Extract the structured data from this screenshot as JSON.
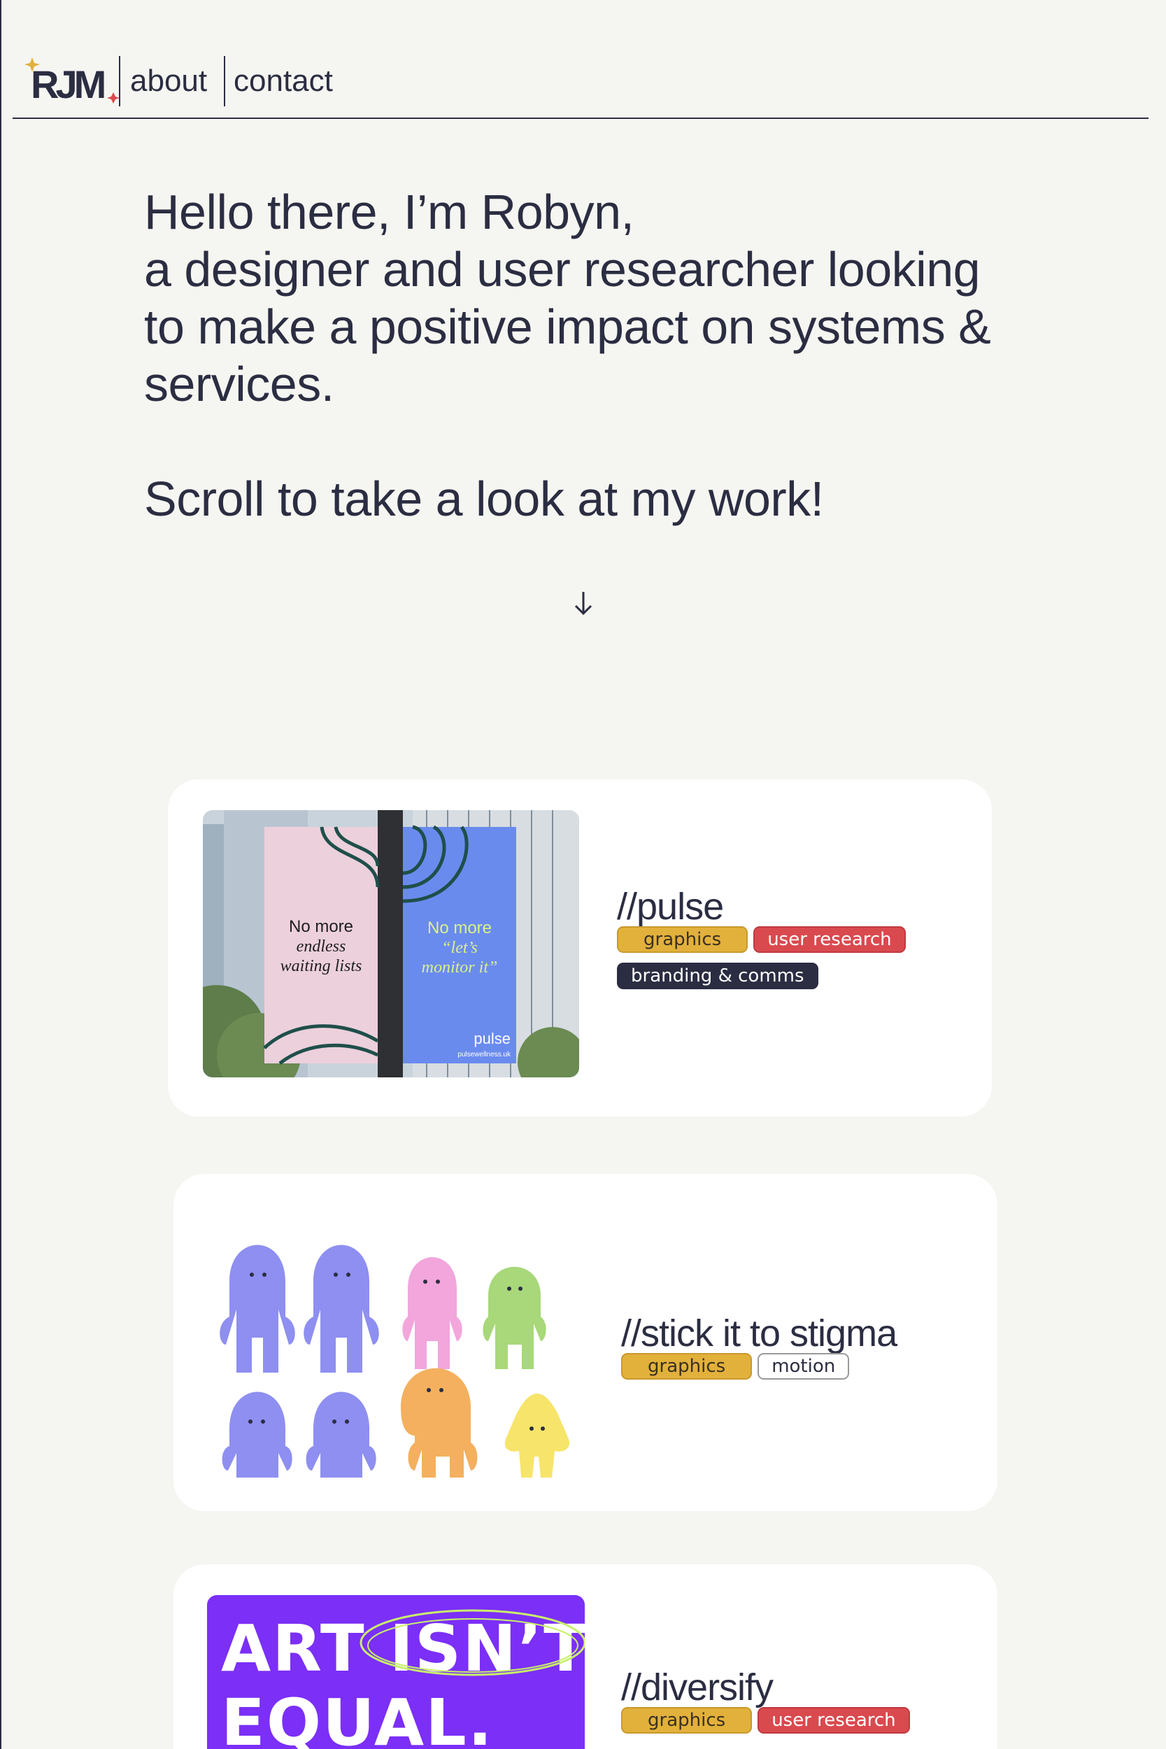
{
  "nav": {
    "logo_text": "RJM",
    "links": [
      {
        "label": "about"
      },
      {
        "label": "contact"
      }
    ]
  },
  "intro": {
    "greeting": "Hello there, I’m Robyn,",
    "line1": "a designer and user researcher looking",
    "line2": "to make a positive impact on systems &",
    "line3": "services.",
    "cta": "Scroll to take a look at my work!",
    "arrow": "↓"
  },
  "projects": [
    {
      "title": "//pulse",
      "tags": [
        "graphics",
        "user research",
        "branding & comms"
      ],
      "image": {
        "icon": "street-banner-image",
        "banner_left": {
          "line1": "No more",
          "line2": "endless",
          "line3": "waiting lists"
        },
        "banner_right": {
          "line1": "No more",
          "line2": "“let’s",
          "line3": "monitor it”",
          "brand": "pulse",
          "url": "pulsewellness.uk"
        }
      }
    },
    {
      "title": "//stick it to stigma",
      "tags": [
        "graphics",
        "motion"
      ],
      "image": {
        "icon": "characters-illustration"
      }
    },
    {
      "title": "//diversify",
      "tags": [
        "graphics",
        "user research"
      ],
      "image": {
        "icon": "art-poster-image",
        "line1": "ART ISN’T",
        "line2": "EQUAL."
      }
    }
  ],
  "colors": {
    "background": "#f5f5f1",
    "ink": "#2b2d42",
    "graphics_tag": "#e2b13c",
    "research_tag": "#d94a4f",
    "branding_tag": "#2b2d42",
    "poster_purple": "#7b2ff7",
    "banner_pink": "#ecd0dc",
    "banner_blue": "#6a8bee"
  }
}
